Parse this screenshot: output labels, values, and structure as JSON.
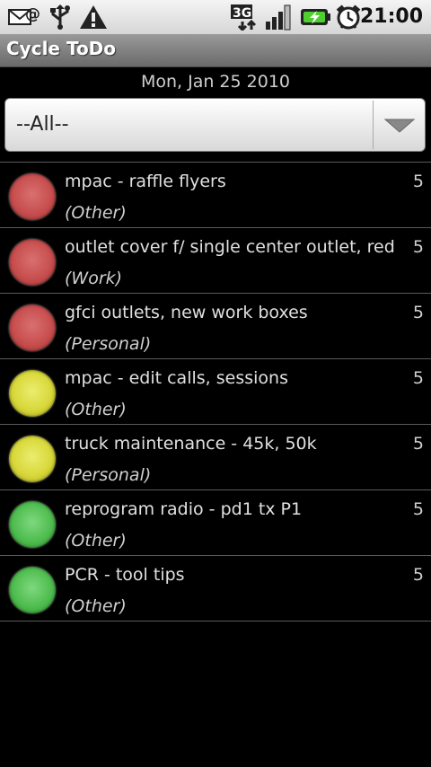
{
  "status_bar": {
    "icons": [
      "email-icon",
      "usb-icon",
      "warning-icon",
      "3g-data-icon",
      "signal-icon",
      "battery-charging-icon",
      "alarm-clock-icon"
    ],
    "network": "3G",
    "time": "21:00"
  },
  "app": {
    "title": "Cycle ToDo"
  },
  "date": "Mon, Jan 25 2010",
  "filter": {
    "selected": "--All--"
  },
  "colors": {
    "red": "#c84e4e",
    "yellow": "#d8d83a",
    "green": "#4fbd4f"
  },
  "items": [
    {
      "title": "mpac - raffle flyers",
      "category": "(Other)",
      "count": "5",
      "status": "red"
    },
    {
      "title": "outlet cover f/ single center outlet, red",
      "category": "(Work)",
      "count": "5",
      "status": "red"
    },
    {
      "title": "gfci outlets, new work boxes",
      "category": "(Personal)",
      "count": "5",
      "status": "red"
    },
    {
      "title": "mpac - edit calls, sessions",
      "category": "(Other)",
      "count": "5",
      "status": "yellow"
    },
    {
      "title": "truck maintenance - 45k, 50k",
      "category": "(Personal)",
      "count": "5",
      "status": "yellow"
    },
    {
      "title": "reprogram radio - pd1 tx P1",
      "category": "(Other)",
      "count": "5",
      "status": "green"
    },
    {
      "title": "PCR - tool tips",
      "category": "(Other)",
      "count": "5",
      "status": "green"
    }
  ]
}
